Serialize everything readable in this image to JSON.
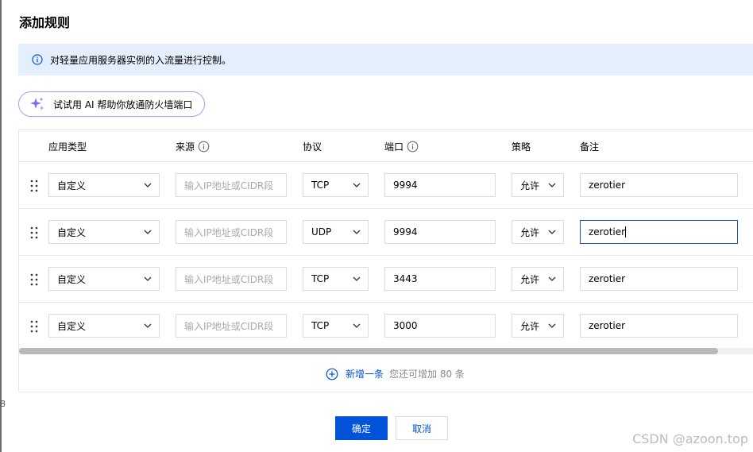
{
  "dialog": {
    "title": "添加规则",
    "info_text": "对轻量应用服务器实例的入流量进行控制。",
    "ai_button_label": "试试用 AI 帮助你放通防火墙端口"
  },
  "table": {
    "headers": {
      "app_type": "应用类型",
      "source": "来源",
      "protocol": "协议",
      "port": "端口",
      "policy": "策略",
      "remark": "备注"
    },
    "rows": [
      {
        "app_type": "自定义",
        "source_placeholder": "输入IP地址或CIDR段",
        "protocol": "TCP",
        "port": "9994",
        "policy": "允许",
        "remark": "zerotier"
      },
      {
        "app_type": "自定义",
        "source_placeholder": "输入IP地址或CIDR段",
        "protocol": "UDP",
        "port": "9994",
        "policy": "允许",
        "remark": "zerotier"
      },
      {
        "app_type": "自定义",
        "source_placeholder": "输入IP地址或CIDR段",
        "protocol": "TCP",
        "port": "3443",
        "policy": "允许",
        "remark": "zerotier"
      },
      {
        "app_type": "自定义",
        "source_placeholder": "输入IP地址或CIDR段",
        "protocol": "TCP",
        "port": "3000",
        "policy": "允许",
        "remark": "zerotier"
      }
    ],
    "add_row_label": "新增一条",
    "add_row_hint": "您还可增加 80 条"
  },
  "footer": {
    "confirm_label": "确定",
    "cancel_label": "取消"
  },
  "watermark": "CSDN @azoon.top",
  "stray_char": "8",
  "colors": {
    "primary": "#0052d9",
    "banner_bg": "#e5eefd",
    "border": "#dcdcdc",
    "placeholder": "#a8a8a8"
  }
}
